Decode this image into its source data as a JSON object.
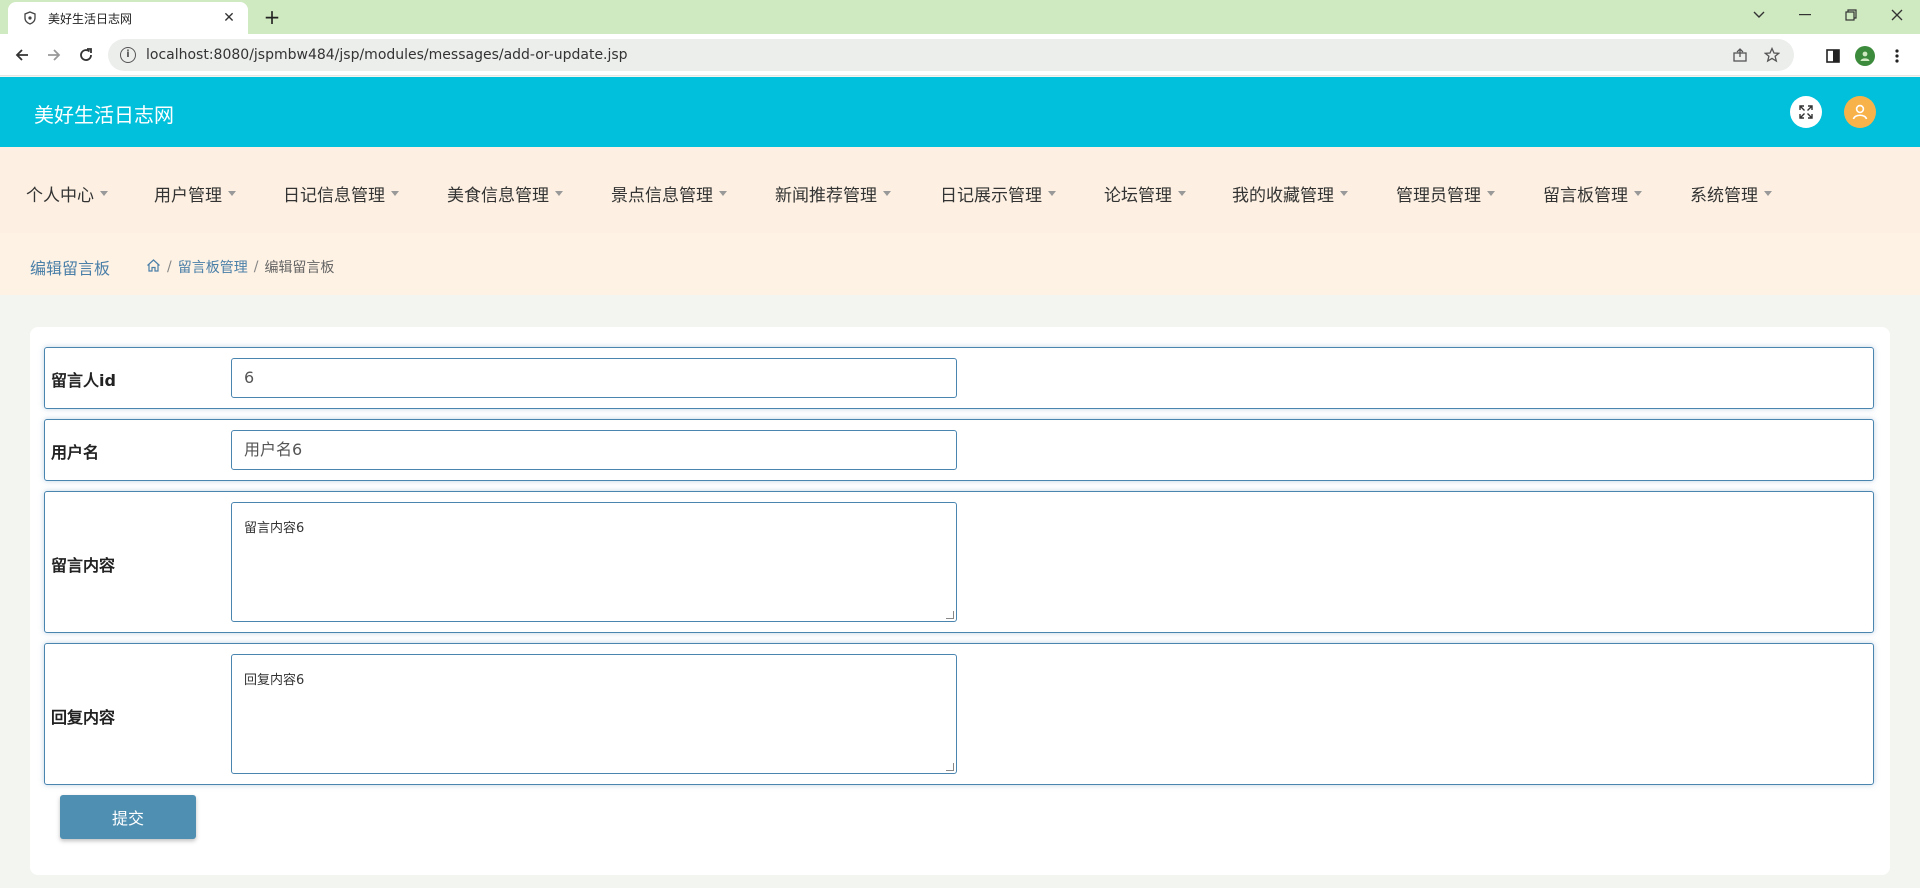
{
  "browser": {
    "tab_title": "美好生活日志网",
    "new_tab": "+",
    "url": "localhost:8080/jspmbw484/jsp/modules/messages/add-or-update.jsp"
  },
  "app": {
    "title": "美好生活日志网"
  },
  "menu": {
    "items": [
      {
        "label": "个人中心"
      },
      {
        "label": "用户管理"
      },
      {
        "label": "日记信息管理"
      },
      {
        "label": "美食信息管理"
      },
      {
        "label": "景点信息管理"
      },
      {
        "label": "新闻推荐管理"
      },
      {
        "label": "日记展示管理"
      },
      {
        "label": "论坛管理"
      },
      {
        "label": "我的收藏管理"
      },
      {
        "label": "管理员管理"
      },
      {
        "label": "留言板管理"
      },
      {
        "label": "系统管理"
      }
    ]
  },
  "breadcrumb": {
    "page_title": "编辑留言板",
    "sep": "/",
    "parent": "留言板管理",
    "current": "编辑留言板"
  },
  "form": {
    "user_id": {
      "label": "留言人id",
      "value": "6"
    },
    "username": {
      "label": "用户名",
      "value": "用户名6"
    },
    "message": {
      "label": "留言内容",
      "value": "留言内容6"
    },
    "reply": {
      "label": "回复内容",
      "value": "回复内容6"
    },
    "submit_label": "提交"
  },
  "colors": {
    "header_bg": "#00c0dc",
    "menu_bg": "#fdf0e2",
    "accent": "#4a85b0",
    "submit_bg": "#4f8fb2",
    "tabbar_bg": "#cfe9c0"
  }
}
